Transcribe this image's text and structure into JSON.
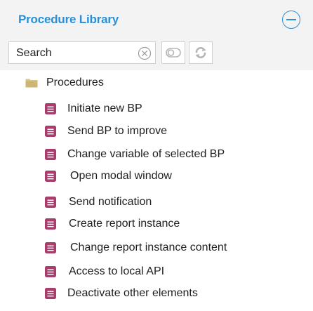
{
  "header": {
    "title": "Procedure Library",
    "collapse_icon": "collapse-circle-icon"
  },
  "search": {
    "placeholder": "Search",
    "clear_icon": "clear-x-circle-icon",
    "toggle_icon": "toggle-icon",
    "refresh_icon": "refresh-icon"
  },
  "tree": {
    "folder": {
      "label": "Procedures",
      "icon": "folder-icon"
    },
    "items": [
      {
        "label": "Initiate new BP"
      },
      {
        "label": "Send BP to improve"
      },
      {
        "label": "Change variable of selected BP"
      },
      {
        "label": "Open modal window"
      },
      {
        "label": "Send notification"
      },
      {
        "label": "Create report instance"
      },
      {
        "label": "Change report instance content"
      },
      {
        "label": "Access to local API"
      },
      {
        "label": "Deactivate other elements"
      }
    ],
    "item_icon": "procedure-doc-icon"
  },
  "colors": {
    "accent": "#2a8fd4",
    "procedure_icon": "#a83d6c",
    "folder_icon": "#d9c486",
    "panel_bg": "#f3f3f3"
  }
}
